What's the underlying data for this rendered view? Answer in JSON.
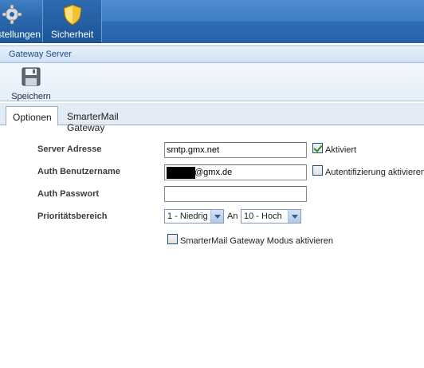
{
  "nav": {
    "settings_label": "Einstellungen",
    "security_label": "Sicherheit",
    "settings_icon": "gear-icon",
    "security_icon": "shield-icon"
  },
  "panel": {
    "title": "Gateway Server"
  },
  "toolbar": {
    "save_label": "Speichern",
    "save_icon": "floppy-disk-icon"
  },
  "tabs": [
    {
      "label": "Optionen",
      "active": true
    },
    {
      "label": "SmarterMail Gateway",
      "active": false
    }
  ],
  "form": {
    "server_address": {
      "label": "Server Adresse",
      "value": "smtp.gmx.net"
    },
    "enabled": {
      "label": "Aktiviert",
      "checked": true
    },
    "auth_user": {
      "label": "Auth Benutzername",
      "value_suffix": "@gmx.de"
    },
    "auth_required": {
      "label": "Autentifizierung aktivieren",
      "checked": false
    },
    "auth_password": {
      "label": "Auth Passwort",
      "value": ""
    },
    "priority": {
      "label": "Prioritätsbereich",
      "from": "1 - Niedrig",
      "separator": "An",
      "to": "10 - Hoch"
    },
    "gateway_mode": {
      "label": "SmarterMail Gateway Modus aktivieren",
      "checked": false
    }
  },
  "colors": {
    "nav_bg": "#2a66ab",
    "panel_title": "#1b4a86",
    "check": "#2e8b1f"
  }
}
